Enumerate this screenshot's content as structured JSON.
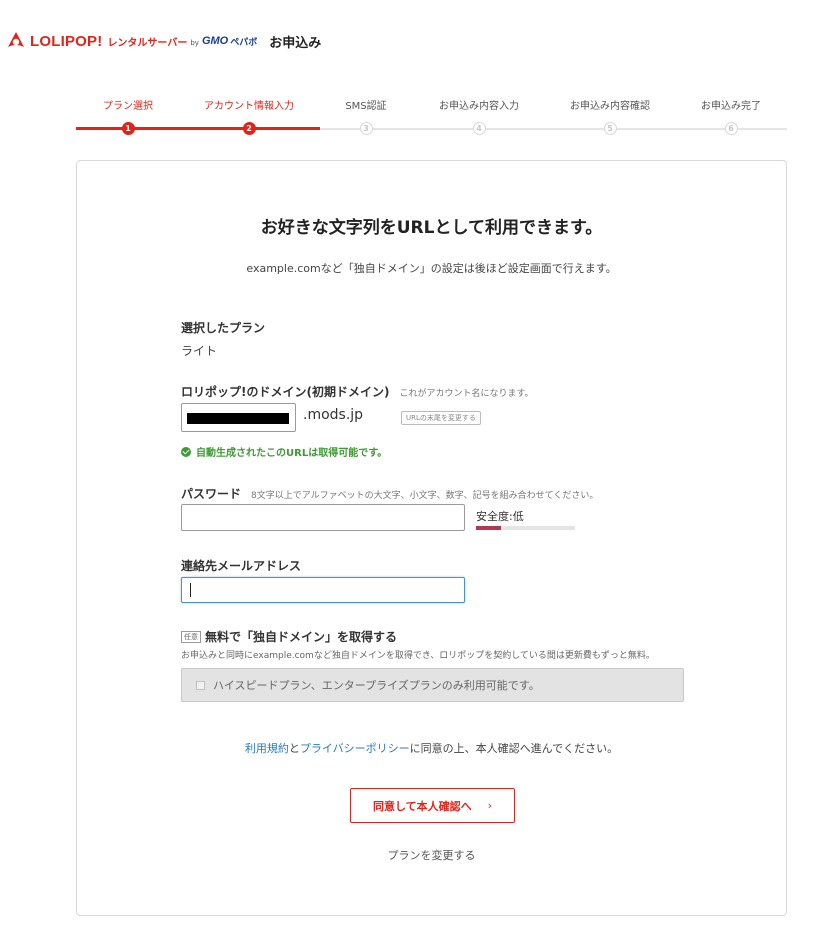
{
  "header": {
    "logo_text": "LOLIPOP!",
    "logo_sub": "レンタルサーバー",
    "logo_by": "by",
    "logo_gmo": "GMO",
    "logo_pepa": "ペパボ",
    "title": "お申込み",
    "brand_color": "#e2231a"
  },
  "stepper": {
    "steps": [
      {
        "label": "プラン選択",
        "num": "1",
        "active": true
      },
      {
        "label": "アカウント情報入力",
        "num": "2",
        "active": true
      },
      {
        "label": "SMS認証",
        "num": "3",
        "active": false
      },
      {
        "label": "お申込み内容入力",
        "num": "4",
        "active": false
      },
      {
        "label": "お申込み内容確認",
        "num": "5",
        "active": false
      },
      {
        "label": "お申込み完了",
        "num": "6",
        "active": false
      }
    ]
  },
  "card": {
    "title": "お好きな文字列をURLとして利用できます。",
    "subtitle": "example.comなど「独自ドメイン」の設定は後ほど設定画面で行えます。"
  },
  "plan": {
    "label": "選択したプラン",
    "value": "ライト"
  },
  "domain": {
    "label": "ロリポップ!のドメイン(初期ドメイン)",
    "note": "これがアカウント名になります。",
    "value": "",
    "suffix": ".mods.jp",
    "change_label": "URLの末尾を変更する",
    "ok_message": "自動生成されたこのURLは取得可能です。",
    "ok_color": "#3c9c33"
  },
  "password": {
    "label": "パスワード",
    "note": "8文字以上でアルファベットの大文字、小文字、数字、記号を組み合わせてください。",
    "value": "",
    "strength_label": "安全度:低",
    "strength_level": 0.25,
    "strength_color": "#b03a55"
  },
  "email": {
    "label": "連絡先メールアドレス",
    "value": ""
  },
  "optional_domain": {
    "badge": "任意",
    "label": "無料で「独自ドメイン」を取得する",
    "description": "お申込みと同時にexample.comなど独自ドメインを取得でき、ロリポップを契約している間は更新費もずっと無料。",
    "checkbox_label": "ハイスピードプラン、エンタープライズプランのみ利用可能です。"
  },
  "terms": {
    "link1": "利用規約",
    "and": "と",
    "link2": "プライバシーポリシー",
    "rest": "に同意の上、本人確認へ進んでください。"
  },
  "actions": {
    "agree_label": "同意して本人確認へ",
    "chevron": "›",
    "change_plan_label": "プランを変更する"
  }
}
